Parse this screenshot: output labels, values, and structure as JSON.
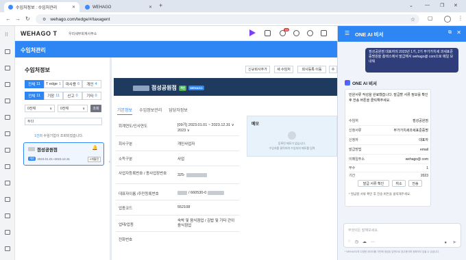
{
  "browser": {
    "tabs": [
      {
        "title": "수임처정보 : 수임처관리"
      },
      {
        "title": "WEHAGO"
      }
    ],
    "new_tab": "+",
    "url": "wehago.com/tedge/#/taxagent",
    "window_controls": [
      "⌄",
      "—",
      "❐",
      "✕"
    ]
  },
  "header": {
    "logo": "WEHAGO T",
    "company": "우리세무회계사무소",
    "badge": "65"
  },
  "page": {
    "title": "수임처관리"
  },
  "left": {
    "section_title": "수임처정보",
    "filter_row1": [
      {
        "label": "전체",
        "count": "11",
        "active": true
      },
      {
        "label": "T edge",
        "count": "1",
        "active": false
      },
      {
        "label": "마사용",
        "count": "6",
        "active": false
      },
      {
        "label": "개인",
        "count": "4",
        "active": false
      }
    ],
    "filter_row2": [
      {
        "label": "전체",
        "count": "11",
        "active": true
      },
      {
        "label": "기장",
        "count": "11",
        "active": false
      },
      {
        "label": "신고",
        "count": "0",
        "active": false
      },
      {
        "label": "기타",
        "count": "0",
        "active": false
      }
    ],
    "select1": "0전체",
    "select2": "0전체",
    "search_button": "조회",
    "search_value": "두다",
    "result_count": "1건",
    "result_suffix": "의 수임기업이 조회되었습니다.",
    "card": {
      "name": "점성공원점",
      "pill": "개인",
      "date": "2023.01.01~2023.12.31",
      "tag": "2개월전"
    }
  },
  "main": {
    "top_buttons": [
      "신규회사추가",
      "새 수임처",
      "회사등록 이동",
      "수"
    ],
    "company_name": "점성공원점",
    "tag_personal": "개인",
    "tag_wehago": "WEHAGO",
    "subtabs": [
      "기본정보",
      "수임정보관리",
      "담당자정보"
    ],
    "rows": [
      {
        "label": "회계연도/인사연도",
        "value": "[09기] 2023.01.01 ~ 2023.12.31 ∨"
      },
      {
        "label": "",
        "value": "2023 ∨"
      },
      {
        "label": "회사구분",
        "value": "개인사업자"
      },
      {
        "label": "소득구분",
        "value": "사업"
      },
      {
        "label": "사업자등록번호 / 종사업장번호",
        "value": "325-"
      },
      {
        "label": "대표자이름 /주민등록번호",
        "value": "/ 660530-0"
      },
      {
        "label": "업종코드",
        "value": "552108"
      },
      {
        "label": "업태/업종",
        "value": "숙박 및 음식점업 / 김밥 및 기타 간이 음식점업"
      },
      {
        "label": "전화번호",
        "value": ""
      }
    ],
    "memo": {
      "title": "메모",
      "desc1": "등록된 메모가 없습니다.",
      "desc2": "수임처를 클릭하여 수임처의 메모를 입력"
    }
  },
  "assistant": {
    "title": "ONE AI 비서",
    "user_message": "점성공원점 대표자의 2023년 1기, 2기 부가가치세 과세표준증명원을 홈택스에서 발급해서 wehago@ com으로 메일 보내줘",
    "bot_name": "ONE AI 비서",
    "bot_message": "민원서류 작성을 완료했습니다. 발급할 서류 정보를 확인 후 전송 버튼을 클릭해주세요.",
    "fields": [
      {
        "key": "수임처",
        "value": "점성공원점"
      },
      {
        "key": "신청서류",
        "value": "부가가치세과세표준증명"
      },
      {
        "key": "신청자",
        "value": "대표자"
      },
      {
        "key": "발급방법",
        "value": "email"
      },
      {
        "key": "이메일주소",
        "value": "wehago@  com"
      },
      {
        "key": "부수",
        "value": "1"
      },
      {
        "key": "기간",
        "value": "2023"
      }
    ],
    "buttons": [
      "발급 서류 확인",
      "취소",
      "전송"
    ],
    "note": "* 발급할 서류 확인 후 전송 버튼을 클릭해주세요.",
    "input_placeholder": "무엇이든 말해보세요.",
    "disclaimer": "* WEHAGO의 다양한 데이터를 기반해 생성된 답변으로 참고용이며 정확하지 않을 수 있습니다."
  }
}
